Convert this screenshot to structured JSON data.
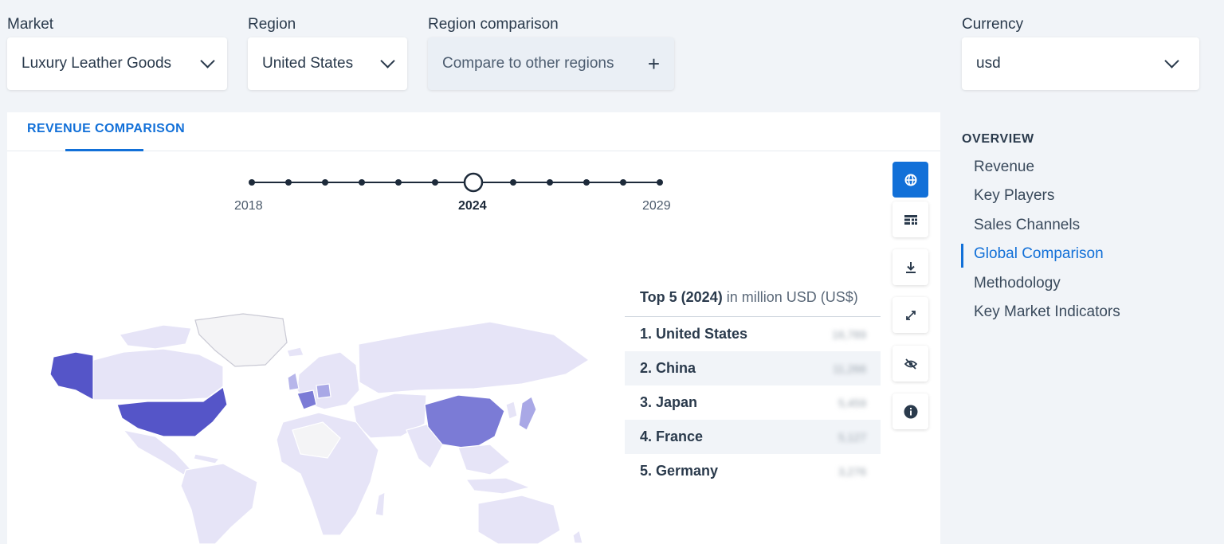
{
  "filters": {
    "market": {
      "label": "Market",
      "value": "Luxury Leather Goods"
    },
    "region": {
      "label": "Region",
      "value": "United States"
    },
    "comparison": {
      "label": "Region comparison",
      "placeholder": "Compare to other regions"
    },
    "currency": {
      "label": "Currency",
      "value": "usd"
    }
  },
  "tab": {
    "label": "REVENUE COMPARISON"
  },
  "timeline": {
    "start": "2018",
    "active": "2024",
    "end": "2029"
  },
  "side_buttons": [
    "globe-icon",
    "table-icon",
    "download-icon",
    "expand-icon",
    "hide-icon",
    "info-icon"
  ],
  "top5": {
    "title_bold": "Top 5 (2024)",
    "title_rest": " in million USD (US$)",
    "rows": [
      {
        "label": "1. United States",
        "value": "16,789"
      },
      {
        "label": "2. China",
        "value": "11,266"
      },
      {
        "label": "3. Japan",
        "value": "5,459"
      },
      {
        "label": "4. France",
        "value": "5,127"
      },
      {
        "label": "5. Germany",
        "value": "3,276"
      }
    ]
  },
  "overview": {
    "title": "OVERVIEW",
    "items": [
      "Revenue",
      "Key Players",
      "Sales Channels",
      "Global Comparison",
      "Methodology",
      "Key Market Indicators"
    ],
    "active": "Global Comparison"
  },
  "colors": {
    "accent": "#1270d8",
    "map_dark": "#5555c8",
    "map_mid": "#7b7bd6",
    "map_light": "#e6e4f7"
  }
}
